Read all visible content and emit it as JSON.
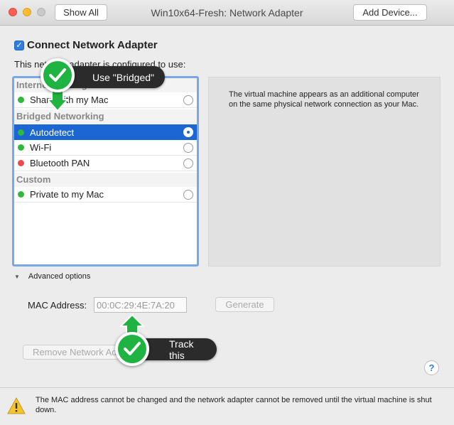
{
  "window": {
    "title": "Win10x64-Fresh: Network Adapter",
    "show_all": "Show All",
    "add_device": "Add Device..."
  },
  "adapter": {
    "connect_label": "Connect Network Adapter",
    "description": "This network adapter is configured to use:"
  },
  "list": {
    "groups": [
      {
        "header": "Internet Sharing"
      },
      {
        "header": "Bridged Networking"
      },
      {
        "header": "Custom"
      }
    ],
    "items": [
      {
        "label": "Share with my Mac",
        "status": "green",
        "selected": false
      },
      {
        "label": "Autodetect",
        "status": "green",
        "selected": true
      },
      {
        "label": "Wi-Fi",
        "status": "green",
        "selected": false
      },
      {
        "label": "Bluetooth PAN",
        "status": "red",
        "selected": false
      },
      {
        "label": "Private to my Mac",
        "status": "green",
        "selected": false
      }
    ]
  },
  "info_text": "The virtual machine appears as an additional computer on the same physical network connection as your Mac.",
  "advanced": {
    "toggle_label": "Advanced options",
    "mac_label": "MAC Address:",
    "mac_value": "00:0C:29:4E:7A:20",
    "generate": "Generate"
  },
  "remove_button": "Remove Network Adapter",
  "help_symbol": "?",
  "footer_warning": "The MAC address cannot be changed and the network adapter cannot be removed until the virtual machine is shut down.",
  "callouts": {
    "bridged": "Use \"Bridged\"",
    "track": "Track this"
  },
  "colors": {
    "selection": "#1c66d4",
    "status_green": "#2fb83c",
    "status_red": "#f0494a",
    "callout_green": "#1fb341",
    "list_focus": "#7aa7e6"
  }
}
